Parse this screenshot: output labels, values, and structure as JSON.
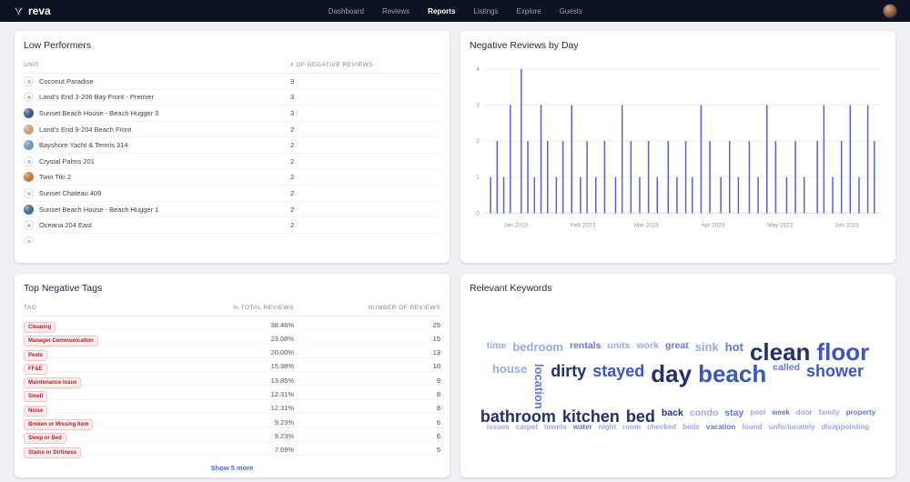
{
  "nav": {
    "brand": "reva",
    "items": [
      {
        "label": "Dashboard",
        "active": false
      },
      {
        "label": "Reviews",
        "active": false
      },
      {
        "label": "Reports",
        "active": true
      },
      {
        "label": "Listings",
        "active": false
      },
      {
        "label": "Explore",
        "active": false
      },
      {
        "label": "Guests",
        "active": false
      }
    ]
  },
  "low_performers": {
    "title": "Low Performers",
    "columns": [
      "Unit",
      "# of Negative Reviews"
    ],
    "rows": [
      {
        "name": "Coconut Paradise",
        "count": "3",
        "avatar": {
          "type": "placeholder"
        }
      },
      {
        "name": "Land's End 3-206 Bay Front - Premier",
        "count": "3",
        "avatar": {
          "type": "placeholder"
        }
      },
      {
        "name": "Sunset Beach House - Beach Hugger 3",
        "count": "3",
        "avatar": {
          "type": "photo",
          "color": "#3f5e8f"
        }
      },
      {
        "name": "Land's End 9-204 Beach Front",
        "count": "2",
        "avatar": {
          "type": "photo",
          "color": "#c6a178"
        }
      },
      {
        "name": "Bayshore Yacht & Tennis 314",
        "count": "2",
        "avatar": {
          "type": "photo",
          "color": "#7b94ba"
        }
      },
      {
        "name": "Crystal Palms 201",
        "count": "2",
        "avatar": {
          "type": "placeholder"
        }
      },
      {
        "name": "Twin Tiki 2",
        "count": "2",
        "avatar": {
          "type": "photo",
          "color": "#c57a45"
        }
      },
      {
        "name": "Sunset Chateau 409",
        "count": "2",
        "avatar": {
          "type": "placeholder"
        }
      },
      {
        "name": "Sunset Beach House - Beach Hugger 1",
        "count": "2",
        "avatar": {
          "type": "photo",
          "color": "#49709f"
        }
      },
      {
        "name": "Oceana 204 East",
        "count": "2",
        "avatar": {
          "type": "placeholder"
        }
      },
      {
        "name": "",
        "count": "",
        "avatar": {
          "type": "placeholder"
        }
      }
    ]
  },
  "chart_data": {
    "type": "bar",
    "title": "Negative Reviews by Day",
    "ylabel": "",
    "xlabel": "",
    "ylim": [
      0,
      4
    ],
    "yticks": [
      0,
      1,
      2,
      3,
      4
    ],
    "grid": true,
    "bar_color": "#5a5ed1",
    "x_domain_days": 181,
    "x_labels": [
      {
        "label": "Jan 2023",
        "f": 0.08
      },
      {
        "label": "Feb 2023",
        "f": 0.249
      },
      {
        "label": "Mar 2023",
        "f": 0.409
      },
      {
        "label": "Apr 2023",
        "f": 0.577
      },
      {
        "label": "May 2023",
        "f": 0.746
      },
      {
        "label": "Jun 2023",
        "f": 0.914
      }
    ],
    "bars": [
      [
        3,
        1
      ],
      [
        6,
        2
      ],
      [
        9,
        1
      ],
      [
        12,
        3
      ],
      [
        17,
        4
      ],
      [
        20,
        2
      ],
      [
        23,
        1
      ],
      [
        26,
        3
      ],
      [
        29,
        2
      ],
      [
        33,
        1
      ],
      [
        36,
        2
      ],
      [
        40,
        3
      ],
      [
        44,
        1
      ],
      [
        47,
        2
      ],
      [
        51,
        1
      ],
      [
        55,
        2
      ],
      [
        60,
        1
      ],
      [
        63,
        3
      ],
      [
        67,
        2
      ],
      [
        71,
        1
      ],
      [
        75,
        2
      ],
      [
        79,
        1
      ],
      [
        84,
        2
      ],
      [
        88,
        1
      ],
      [
        92,
        2
      ],
      [
        95,
        1
      ],
      [
        99,
        3
      ],
      [
        103,
        2
      ],
      [
        108,
        1
      ],
      [
        112,
        2
      ],
      [
        116,
        1
      ],
      [
        121,
        2
      ],
      [
        125,
        1
      ],
      [
        129,
        3
      ],
      [
        133,
        2
      ],
      [
        138,
        1
      ],
      [
        142,
        2
      ],
      [
        146,
        1
      ],
      [
        152,
        2
      ],
      [
        155,
        3
      ],
      [
        159,
        1
      ],
      [
        163,
        2
      ],
      [
        167,
        3
      ],
      [
        171,
        1
      ],
      [
        175,
        3
      ],
      [
        178,
        2
      ]
    ]
  },
  "tags": {
    "title": "Top Negative Tags",
    "columns": [
      "Tag",
      "% Total Reviews",
      "Number of Reviews"
    ],
    "badge_colors": {
      "text": "#b4232a",
      "bg": "#fdeeee",
      "border": "#f3c2c4"
    },
    "rows": [
      {
        "tag": "Cleaning",
        "pct": "38.46%",
        "count": "25"
      },
      {
        "tag": "Manager Communication",
        "pct": "23.08%",
        "count": "15"
      },
      {
        "tag": "Pests",
        "pct": "20.00%",
        "count": "13"
      },
      {
        "tag": "FF&E",
        "pct": "15.38%",
        "count": "10"
      },
      {
        "tag": "Maintenance Issue",
        "pct": "13.85%",
        "count": "9"
      },
      {
        "tag": "Smell",
        "pct": "12.31%",
        "count": "8"
      },
      {
        "tag": "Noise",
        "pct": "12.31%",
        "count": "8"
      },
      {
        "tag": "Broken or Missing Item",
        "pct": "9.23%",
        "count": "6"
      },
      {
        "tag": "Sleep or Bed",
        "pct": "9.23%",
        "count": "6"
      },
      {
        "tag": "Stains or Dirtiness",
        "pct": "7.69%",
        "count": "5"
      }
    ],
    "show_more": "Show 5 more"
  },
  "keywords": {
    "title": "Relevant Keywords",
    "palette": {
      "navy": "#22306b",
      "blue": "#3c55c5",
      "mid": "#6379d3",
      "light": "#9aa9e4"
    },
    "sizes": [
      0,
      8,
      10.5,
      13,
      18,
      26
    ],
    "words": [
      {
        "t": "time",
        "w": 2,
        "c": "light"
      },
      {
        "t": "bedroom",
        "w": 3,
        "c": "light"
      },
      {
        "t": "rentals",
        "w": 2,
        "c": "mid"
      },
      {
        "t": "units",
        "w": 2,
        "c": "light"
      },
      {
        "t": "work",
        "w": 2,
        "c": "light"
      },
      {
        "t": "great",
        "w": 2,
        "c": "mid"
      },
      {
        "t": "sink",
        "w": 3,
        "c": "light"
      },
      {
        "t": "hot",
        "w": 3,
        "c": "mid"
      },
      {
        "t": "clean",
        "w": 5,
        "c": "navy"
      },
      {
        "t": "floor",
        "w": 5,
        "c": "blue"
      },
      {
        "t": "house",
        "w": 3,
        "c": "light"
      },
      {
        "t": "location",
        "w": 3,
        "c": "mid",
        "r": true
      },
      {
        "t": "dirty",
        "w": 4,
        "c": "navy"
      },
      {
        "t": "stayed",
        "w": 4,
        "c": "blue"
      },
      {
        "t": "day",
        "w": 5,
        "c": "navy"
      },
      {
        "t": "beach",
        "w": 5,
        "c": "blue"
      },
      {
        "t": "called",
        "w": 2,
        "c": "mid"
      },
      {
        "t": "shower",
        "w": 4,
        "c": "blue"
      },
      {
        "t": "bathroom",
        "w": 4,
        "c": "navy"
      },
      {
        "t": "kitchen",
        "w": 4,
        "c": "navy"
      },
      {
        "t": "bed",
        "w": 4,
        "c": "navy"
      },
      {
        "t": "back",
        "w": 2,
        "c": "navy"
      },
      {
        "t": "condo",
        "w": 2,
        "c": "light"
      },
      {
        "t": "stay",
        "w": 2,
        "c": "mid"
      },
      {
        "t": "pool",
        "w": 1,
        "c": "light"
      },
      {
        "t": "week",
        "w": 1,
        "c": "mid"
      },
      {
        "t": "door",
        "w": 1,
        "c": "light"
      },
      {
        "t": "family",
        "w": 1,
        "c": "light"
      },
      {
        "t": "property",
        "w": 1,
        "c": "mid"
      },
      {
        "t": "issues",
        "w": 1,
        "c": "light"
      },
      {
        "t": "carpet",
        "w": 1,
        "c": "light"
      },
      {
        "t": "towels",
        "w": 1,
        "c": "light"
      },
      {
        "t": "water",
        "w": 1,
        "c": "mid"
      },
      {
        "t": "night",
        "w": 1,
        "c": "light"
      },
      {
        "t": "room",
        "w": 1,
        "c": "light"
      },
      {
        "t": "checked",
        "w": 1,
        "c": "light"
      },
      {
        "t": "beds",
        "w": 1,
        "c": "light"
      },
      {
        "t": "vacation",
        "w": 1,
        "c": "mid"
      },
      {
        "t": "found",
        "w": 1,
        "c": "light"
      },
      {
        "t": "unfortunately",
        "w": 1,
        "c": "light"
      },
      {
        "t": "disappointing",
        "w": 1,
        "c": "light"
      }
    ]
  }
}
